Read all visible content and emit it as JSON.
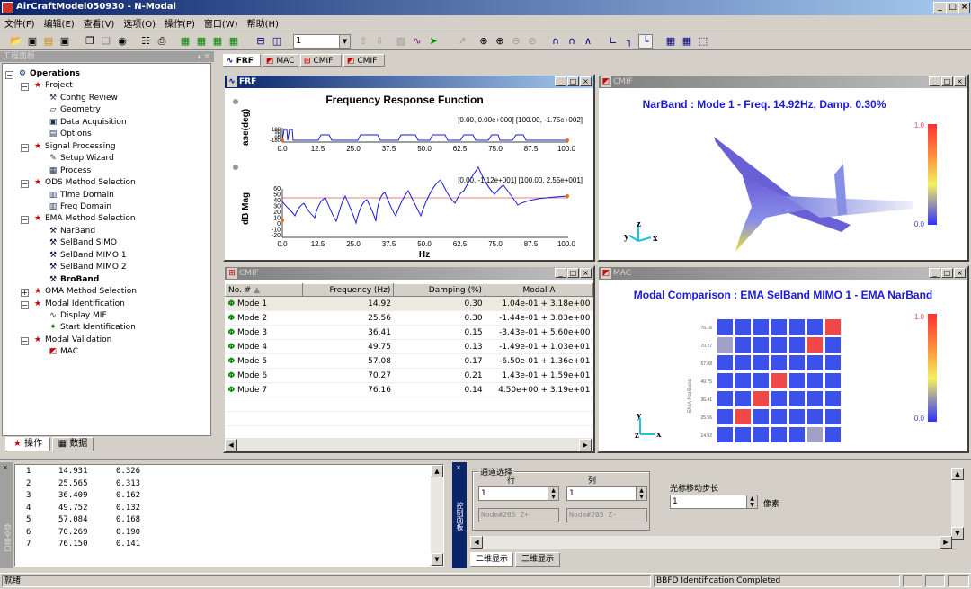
{
  "app": {
    "title": "AirCraftModel050930 - N-Modal",
    "window_buttons": [
      "_",
      "□",
      "×"
    ]
  },
  "menu": [
    "文件(F)",
    "编辑(E)",
    "查看(V)",
    "选项(O)",
    "操作(P)",
    "窗口(W)",
    "帮助(H)"
  ],
  "toolbar": {
    "channel_combo": "1"
  },
  "left_panel": {
    "title": "工程面板",
    "tree": [
      {
        "label": "Operations",
        "level": 0,
        "bold": true,
        "icon": "gear-icon"
      },
      {
        "label": "Project",
        "level": 1,
        "icon": "workflow-icon"
      },
      {
        "label": "Config Review",
        "level": 2,
        "icon": "tools-icon"
      },
      {
        "label": "Geometry",
        "level": 2,
        "icon": "geometry-icon"
      },
      {
        "label": "Data Acquisition",
        "level": 2,
        "icon": "acquisition-icon"
      },
      {
        "label": "Options",
        "level": 2,
        "icon": "options-icon"
      },
      {
        "label": "Signal Processing",
        "level": 1,
        "icon": "workflow-icon"
      },
      {
        "label": "Setup Wizard",
        "level": 2,
        "icon": "wizard-icon"
      },
      {
        "label": "Process",
        "level": 2,
        "icon": "process-icon"
      },
      {
        "label": "ODS Method Selection",
        "level": 1,
        "icon": "workflow-icon"
      },
      {
        "label": "Time Domain",
        "level": 2,
        "icon": "domain-icon"
      },
      {
        "label": "Freq Domain",
        "level": 2,
        "icon": "domain-icon"
      },
      {
        "label": "EMA Method Selection",
        "level": 1,
        "icon": "workflow-icon"
      },
      {
        "label": "NarBand",
        "level": 2,
        "icon": "hammer-icon"
      },
      {
        "label": "SelBand SIMO",
        "level": 2,
        "icon": "hammer-icon"
      },
      {
        "label": "SelBand MIMO 1",
        "level": 2,
        "icon": "hammer-icon"
      },
      {
        "label": "SelBand MIMO 2",
        "level": 2,
        "icon": "hammer-icon"
      },
      {
        "label": "BroBand",
        "level": 2,
        "bold": true,
        "icon": "hammer-icon"
      },
      {
        "label": "OMA Method Selection",
        "level": 1,
        "icon": "workflow-icon"
      },
      {
        "label": "Modal Identification",
        "level": 1,
        "icon": "workflow-icon"
      },
      {
        "label": "Display MIF",
        "level": 2,
        "icon": "mif-icon"
      },
      {
        "label": "Start Identification",
        "level": 2,
        "icon": "identify-icon"
      },
      {
        "label": "Modal Validation",
        "level": 1,
        "icon": "workflow-icon"
      },
      {
        "label": "MAC",
        "level": 2,
        "icon": "mac-icon"
      }
    ],
    "tabs": [
      "操作",
      "数据"
    ]
  },
  "doc_tabs": [
    "FRF",
    "MAC",
    "CMIF",
    "CMIF"
  ],
  "frf": {
    "window_title": "FRF",
    "chart_title": "Frequency Response Function",
    "phase_ylabel": "ase(deg)",
    "mag_ylabel": "dB Mag",
    "xlabel": "Hz",
    "phase_cursor": "[0.00, 0.00e+000] [100.00, -1.75e+002]",
    "mag_cursor": "[0.00, -1.12e+001] [100.00, 2.55e+001]",
    "xticks": [
      "0.0",
      "12.5",
      "25.0",
      "37.5",
      "50.0",
      "62.5",
      "75.0",
      "87.5",
      "100.0"
    ],
    "phase_yticks": [
      "180",
      "90",
      "0",
      "-90",
      "-180"
    ],
    "mag_yticks": [
      "60",
      "50",
      "40",
      "30",
      "20",
      "10",
      "0",
      "-10",
      "-20"
    ]
  },
  "cmif_3d": {
    "window_title": "CMIF",
    "heading": "NarBand : Mode  1 - Freq. 14.92Hz, Damp.  0.30%",
    "scale_max": "1.0",
    "scale_min": "0.0",
    "axes": {
      "x": "x",
      "y": "y",
      "z": "z"
    }
  },
  "cmif_table": {
    "window_title": "CMIF",
    "columns": [
      "No. #",
      "Frequency (Hz)",
      "Damping (%)",
      "Modal A"
    ],
    "rows": [
      {
        "mode": "Mode  1",
        "freq": "14.92",
        "damp": "0.30",
        "modal": "1.04e-01 + 3.18e+00"
      },
      {
        "mode": "Mode  2",
        "freq": "25.56",
        "damp": "0.30",
        "modal": "-1.44e-01 + 3.83e+00"
      },
      {
        "mode": "Mode  3",
        "freq": "36.41",
        "damp": "0.15",
        "modal": "-3.43e-01 + 5.60e+00"
      },
      {
        "mode": "Mode  4",
        "freq": "49.75",
        "damp": "0.13",
        "modal": "-1.49e-01 + 1.03e+01"
      },
      {
        "mode": "Mode  5",
        "freq": "57.08",
        "damp": "0.17",
        "modal": "-6.50e-01 + 1.36e+01"
      },
      {
        "mode": "Mode  6",
        "freq": "70.27",
        "damp": "0.21",
        "modal": "1.43e-01 + 1.59e+01"
      },
      {
        "mode": "Mode  7",
        "freq": "76.16",
        "damp": "0.14",
        "modal": "4.50e+00 + 3.19e+01"
      }
    ]
  },
  "mac": {
    "window_title": "MAC",
    "heading": "Modal Comparison : EMA SelBand MIMO 1 - EMA NarBand",
    "scale_max": "1.0",
    "scale_min": "0.0",
    "axis_label": "EMA NarBand",
    "row_labels": [
      "76.16",
      "70.27",
      "57.08",
      "49.75",
      "36.41",
      "25.56",
      "14.92"
    ],
    "col_labels": [
      "14.92",
      "25.56",
      "36.41",
      "49.75",
      "57.08",
      "70.27",
      "76.16"
    ],
    "axes": {
      "x": "x",
      "y": "y",
      "z": "z"
    }
  },
  "chart_data": {
    "type": "heatmap",
    "title": "Modal Comparison : EMA SelBand MIMO 1 - EMA NarBand",
    "ylabel": "EMA NarBand",
    "rows": [
      "76.16",
      "70.27",
      "57.08",
      "49.75",
      "36.41",
      "25.56",
      "14.92"
    ],
    "cols": [
      "14.92",
      "25.56",
      "36.41",
      "49.75",
      "57.08",
      "70.27",
      "76.16"
    ],
    "values": [
      [
        0.05,
        0.05,
        0.05,
        0.05,
        0.05,
        0.05,
        0.95
      ],
      [
        0.2,
        0.05,
        0.05,
        0.05,
        0.05,
        0.95,
        0.05
      ],
      [
        0.05,
        0.05,
        0.05,
        0.05,
        0.05,
        0.05,
        0.05
      ],
      [
        0.05,
        0.05,
        0.05,
        0.95,
        0.05,
        0.05,
        0.05
      ],
      [
        0.05,
        0.05,
        0.95,
        0.05,
        0.05,
        0.05,
        0.05
      ],
      [
        0.05,
        0.95,
        0.05,
        0.05,
        0.05,
        0.05,
        0.05
      ],
      [
        0.05,
        0.05,
        0.05,
        0.05,
        0.05,
        0.3,
        0.05
      ]
    ],
    "range": [
      0.0,
      1.0
    ]
  },
  "output": {
    "side_label": "命令窗口",
    "rows": [
      {
        "n": "1",
        "f": "14.931",
        "d": "0.326"
      },
      {
        "n": "2",
        "f": "25.565",
        "d": "0.313"
      },
      {
        "n": "3",
        "f": "36.409",
        "d": "0.162"
      },
      {
        "n": "4",
        "f": "49.752",
        "d": "0.132"
      },
      {
        "n": "5",
        "f": "57.084",
        "d": "0.168"
      },
      {
        "n": "6",
        "f": "70.269",
        "d": "0.190"
      },
      {
        "n": "7",
        "f": "76.150",
        "d": "0.141"
      }
    ]
  },
  "control": {
    "side_label": "控制面板",
    "group_title": "通道选择",
    "row_label": "行",
    "col_label": "列",
    "row_value": "1",
    "col_value": "1",
    "row_node": "Node#205    Z+",
    "col_node": "Node#205    Z-",
    "step_label": "光标移动步长",
    "step_value": "1",
    "step_unit": "像素",
    "tabs": [
      "二维显示",
      "三维显示"
    ]
  },
  "status": {
    "left": "就绪",
    "message": "BBFD Identification Completed"
  }
}
